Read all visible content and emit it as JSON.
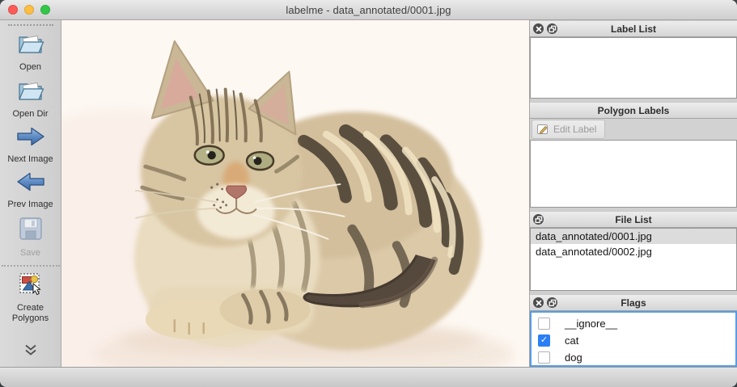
{
  "window": {
    "title": "labelme - data_annotated/0001.jpg"
  },
  "toolbar": {
    "items": [
      {
        "id": "open",
        "label": "Open",
        "icon": "folder-open-icon",
        "enabled": true
      },
      {
        "id": "open-dir",
        "label": "Open Dir",
        "icon": "folder-open-icon",
        "enabled": true
      },
      {
        "id": "next-image",
        "label": "Next Image",
        "icon": "arrow-right-icon",
        "enabled": true
      },
      {
        "id": "prev-image",
        "label": "Prev Image",
        "icon": "arrow-left-icon",
        "enabled": true
      },
      {
        "id": "save",
        "label": "Save",
        "icon": "floppy-disk-icon",
        "enabled": false
      },
      {
        "id": "create-polygons",
        "label": "Create Polygons",
        "icon": "polygon-shapes-icon",
        "enabled": true
      }
    ],
    "overflow_icon": "double-chevron-down-icon"
  },
  "panels": {
    "label_list": {
      "title": "Label List",
      "header_buttons": [
        "close",
        "float"
      ],
      "items": []
    },
    "polygon_labels": {
      "title": "Polygon Labels",
      "edit_button_label": "Edit Label",
      "edit_button_enabled": false,
      "items": []
    },
    "file_list": {
      "title": "File List",
      "header_buttons": [
        "float"
      ],
      "items": [
        {
          "name": "data_annotated/0001.jpg",
          "selected": true
        },
        {
          "name": "data_annotated/0002.jpg",
          "selected": false
        }
      ]
    },
    "flags": {
      "title": "Flags",
      "header_buttons": [
        "close",
        "float"
      ],
      "items": [
        {
          "label": "__ignore__",
          "checked": false
        },
        {
          "label": "cat",
          "checked": true
        },
        {
          "label": "dog",
          "checked": false
        }
      ]
    }
  },
  "canvas": {
    "image_alt": "tabby kitten lying on a white background"
  },
  "colors": {
    "flags_focus_border": "#569de5",
    "checkbox_checked": "#2a7ff5",
    "selected_row": "#dcdcdc",
    "traffic_red": "#fc5b57",
    "traffic_yellow": "#fdbe41",
    "traffic_green": "#33c74a"
  }
}
